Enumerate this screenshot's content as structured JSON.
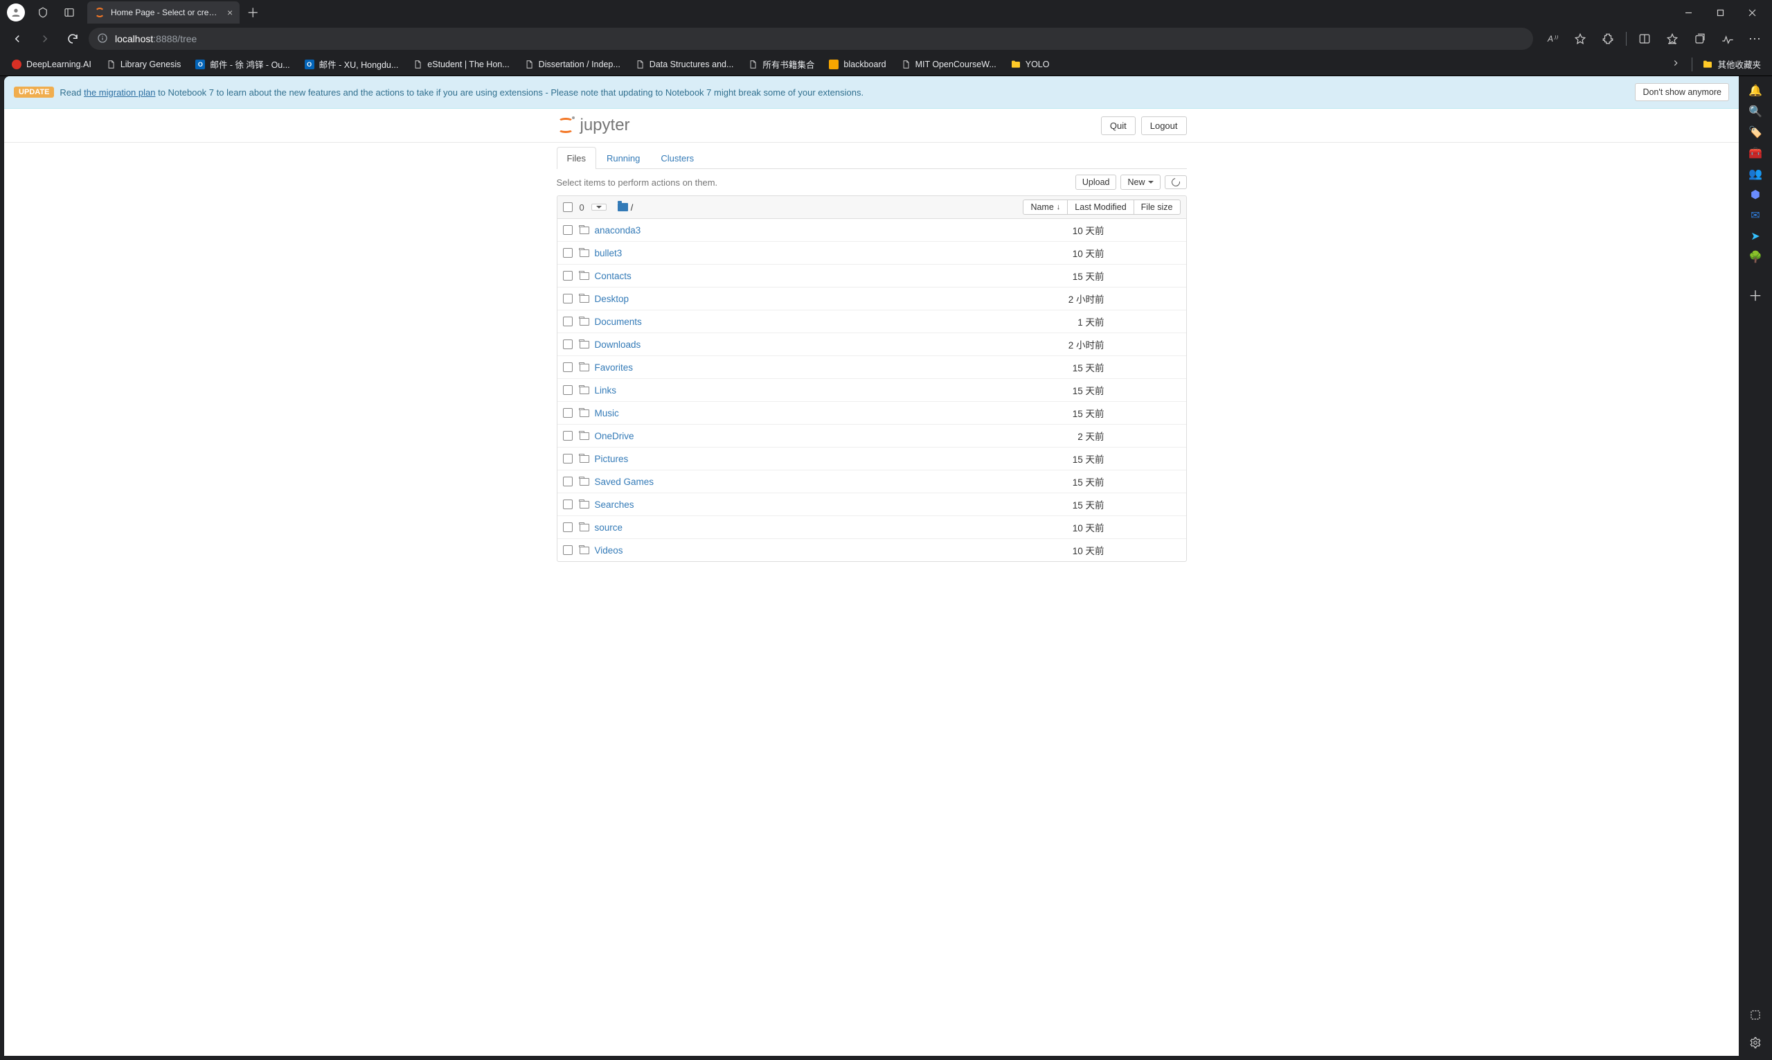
{
  "browser": {
    "tab_title": "Home Page - Select or create a n…",
    "url_host": "localhost",
    "url_rest": ":8888/tree",
    "read_aloud_label": "A⁾⁾",
    "bookmarks": [
      {
        "label": "DeepLearning.AI",
        "favicon": "red-dot"
      },
      {
        "label": "Library Genesis",
        "favicon": "page"
      },
      {
        "label": "邮件 - 徐 鸿铎 - Ou...",
        "favicon": "outlook"
      },
      {
        "label": "邮件 - XU, Hongdu...",
        "favicon": "outlook"
      },
      {
        "label": "eStudent | The Hon...",
        "favicon": "page"
      },
      {
        "label": "Dissertation / Indep...",
        "favicon": "page"
      },
      {
        "label": "Data Structures and...",
        "favicon": "page"
      },
      {
        "label": "所有书籍集合",
        "favicon": "page"
      },
      {
        "label": "blackboard",
        "favicon": "bb"
      },
      {
        "label": "MIT OpenCourseW...",
        "favicon": "page"
      },
      {
        "label": "YOLO",
        "favicon": "folder"
      }
    ],
    "bookmarks_overflow": "其他收藏夹"
  },
  "update_banner": {
    "badge": "UPDATE",
    "pre": "Read ",
    "link": "the migration plan",
    "post": " to Notebook 7 to learn about the new features and the actions to take if you are using extensions - Please note that updating to Notebook 7 might break some of your extensions.",
    "dismiss": "Don't show anymore"
  },
  "header": {
    "logo_text": "jupyter",
    "quit": "Quit",
    "logout": "Logout"
  },
  "tabs": {
    "files": "Files",
    "running": "Running",
    "clusters": "Clusters"
  },
  "toolbar": {
    "hint": "Select items to perform actions on them.",
    "upload": "Upload",
    "new": "New"
  },
  "list_header": {
    "count": "0",
    "breadcrumb_root": "/",
    "col_name": "Name",
    "col_modified": "Last Modified",
    "col_size": "File size"
  },
  "files": [
    {
      "name": "anaconda3",
      "modified": "10 天前",
      "size": ""
    },
    {
      "name": "bullet3",
      "modified": "10 天前",
      "size": ""
    },
    {
      "name": "Contacts",
      "modified": "15 天前",
      "size": ""
    },
    {
      "name": "Desktop",
      "modified": "2 小时前",
      "size": ""
    },
    {
      "name": "Documents",
      "modified": "1 天前",
      "size": ""
    },
    {
      "name": "Downloads",
      "modified": "2 小时前",
      "size": ""
    },
    {
      "name": "Favorites",
      "modified": "15 天前",
      "size": ""
    },
    {
      "name": "Links",
      "modified": "15 天前",
      "size": ""
    },
    {
      "name": "Music",
      "modified": "15 天前",
      "size": ""
    },
    {
      "name": "OneDrive",
      "modified": "2 天前",
      "size": ""
    },
    {
      "name": "Pictures",
      "modified": "15 天前",
      "size": ""
    },
    {
      "name": "Saved Games",
      "modified": "15 天前",
      "size": ""
    },
    {
      "name": "Searches",
      "modified": "15 天前",
      "size": ""
    },
    {
      "name": "source",
      "modified": "10 天前",
      "size": ""
    },
    {
      "name": "Videos",
      "modified": "10 天前",
      "size": ""
    }
  ],
  "sidebar_apps": [
    {
      "name": "notifications",
      "glyph": "🔔",
      "color": "#4da3ff"
    },
    {
      "name": "search",
      "glyph": "🔍",
      "color": "#66b3ff"
    },
    {
      "name": "tag",
      "glyph": "🏷️",
      "color": "#7d8bff"
    },
    {
      "name": "toolbox",
      "glyph": "🧰",
      "color": "#ff6a3d"
    },
    {
      "name": "people",
      "glyph": "👥",
      "color": "#c98bff"
    },
    {
      "name": "office",
      "glyph": "⬢",
      "color": "#6a8cff"
    },
    {
      "name": "outlook",
      "glyph": "✉",
      "color": "#2f7ddc"
    },
    {
      "name": "send",
      "glyph": "➤",
      "color": "#35c1ff"
    },
    {
      "name": "tree",
      "glyph": "🌳",
      "color": "#3bb273"
    }
  ]
}
